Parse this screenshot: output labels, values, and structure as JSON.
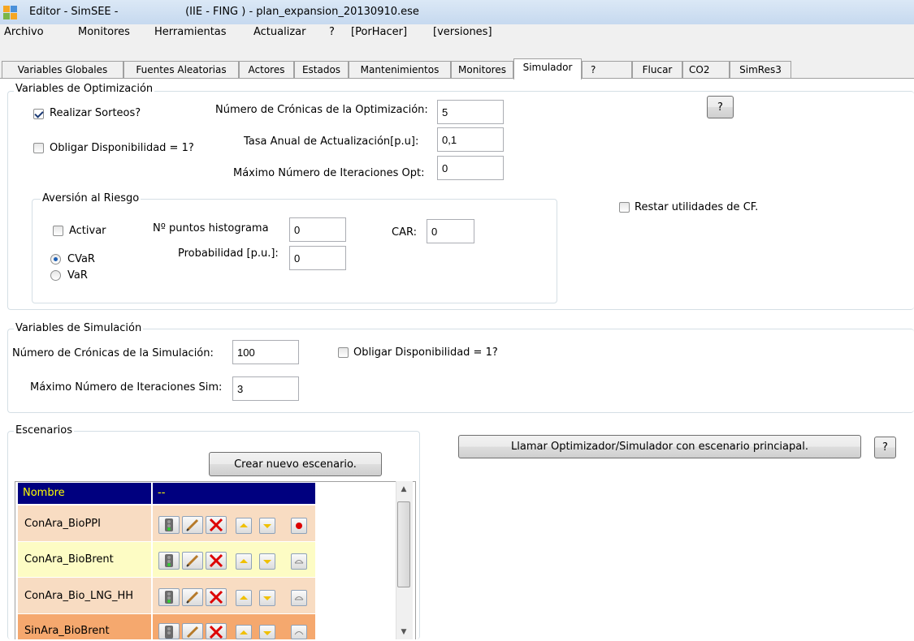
{
  "window": {
    "title": "Editor - SimSEE -                    (IIE - FING ) - plan_expansion_20130910.ese"
  },
  "menu": [
    "Archivo",
    "Monitores",
    "Herramientas",
    "Actualizar",
    "?",
    "[PorHacer]",
    "[versiones]"
  ],
  "tabs": [
    "Variables Globales",
    "Fuentes Aleatorias",
    "Actores",
    "Estados",
    "Mantenimientos",
    "Monitores",
    "Simulador",
    "?",
    "Flucar",
    "CO2",
    "SimRes3"
  ],
  "active_tab": "Simulador",
  "optimizacion": {
    "title": "Variables de Optimización",
    "realizar_sorteos": {
      "label": "Realizar Sorteos?",
      "checked": true
    },
    "obligar_disponibilidad": {
      "label": "Obligar Disponibilidad = 1?",
      "checked": false
    },
    "num_cronicas": {
      "label": "Número de Crónicas de la Optimización:",
      "value": "5"
    },
    "tasa_anual": {
      "label": "Tasa Anual de Actualización[p.u]:",
      "value": "0,1"
    },
    "max_iter": {
      "label": "Máximo Número de Iteraciones Opt:",
      "value": "0"
    },
    "help_label": "?",
    "restar_utilidades": {
      "label": "Restar utilidades de CF.",
      "checked": false
    }
  },
  "riesgo": {
    "title": "Aversión al Riesgo",
    "activar": {
      "label": "Activar",
      "checked": false
    },
    "cvar": {
      "label": "CVaR",
      "selected": true
    },
    "var": {
      "label": "VaR",
      "selected": false
    },
    "puntos_histograma": {
      "label": "Nº puntos histograma",
      "value": "0"
    },
    "probabilidad": {
      "label": "Probabilidad [p.u.]:",
      "value": "0"
    },
    "car": {
      "label": "CAR:",
      "value": "0"
    }
  },
  "simulacion": {
    "title": "Variables de Simulación",
    "num_cronicas": {
      "label": "Número de Crónicas de la Simulación:",
      "value": "100"
    },
    "max_iter": {
      "label": "Máximo Número de Iteraciones Sim:",
      "value": "3"
    },
    "obligar_disponibilidad": {
      "label": "Obligar Disponibilidad = 1?",
      "checked": false
    }
  },
  "escenarios": {
    "title": "Escenarios",
    "crear_label": "Crear nuevo escenario.",
    "columns": [
      "Nombre",
      "--"
    ],
    "rows": [
      {
        "name": "ConAra_BioPPI",
        "color": "#f8dcc2",
        "selected": true
      },
      {
        "name": "ConAra_BioBrent",
        "color": "#fdfcc4",
        "selected": false
      },
      {
        "name": "ConAra_Bio_LNG_HH",
        "color": "#f8dcc2",
        "selected": false
      },
      {
        "name": "SinAra_BioBrent",
        "color": "#f5a86e",
        "selected": false
      }
    ]
  },
  "llamar_label": "Llamar Optimizador/Simulador con escenario princiapal.",
  "llamar_help_label": "?",
  "colors": {
    "header_bg": "#00007f",
    "header_text": "#ffff00"
  }
}
